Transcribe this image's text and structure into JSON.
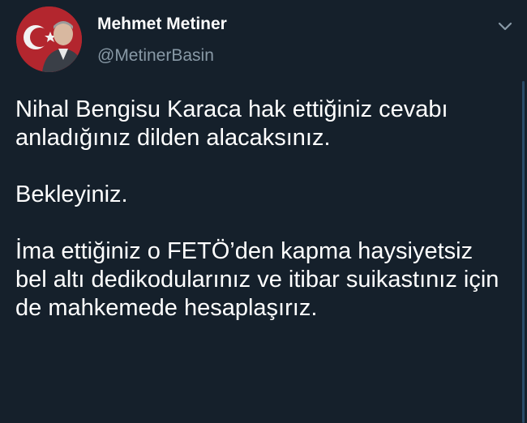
{
  "author": {
    "display_name": "Mehmet Metiner",
    "username": "@MetinerBasin"
  },
  "tweet": {
    "paragraphs": [
      "Nihal Bengisu Karaca hak ettiğiniz cevabı anladığınız dilden alacaksınız.",
      "Bekleyiniz.",
      "İma ettiğiniz o FETÖ’den kapma haysiyetsiz bel altı dedikodularınız ve itibar suikastınız için de mahkemede hesaplaşırız."
    ]
  },
  "icons": {
    "menu": "chevron-down-icon",
    "avatar": "profile-photo"
  },
  "colors": {
    "background": "#15202b",
    "text": "#ffffff",
    "secondary_text": "#8899a6",
    "avatar_flag_red": "#b3262e"
  }
}
